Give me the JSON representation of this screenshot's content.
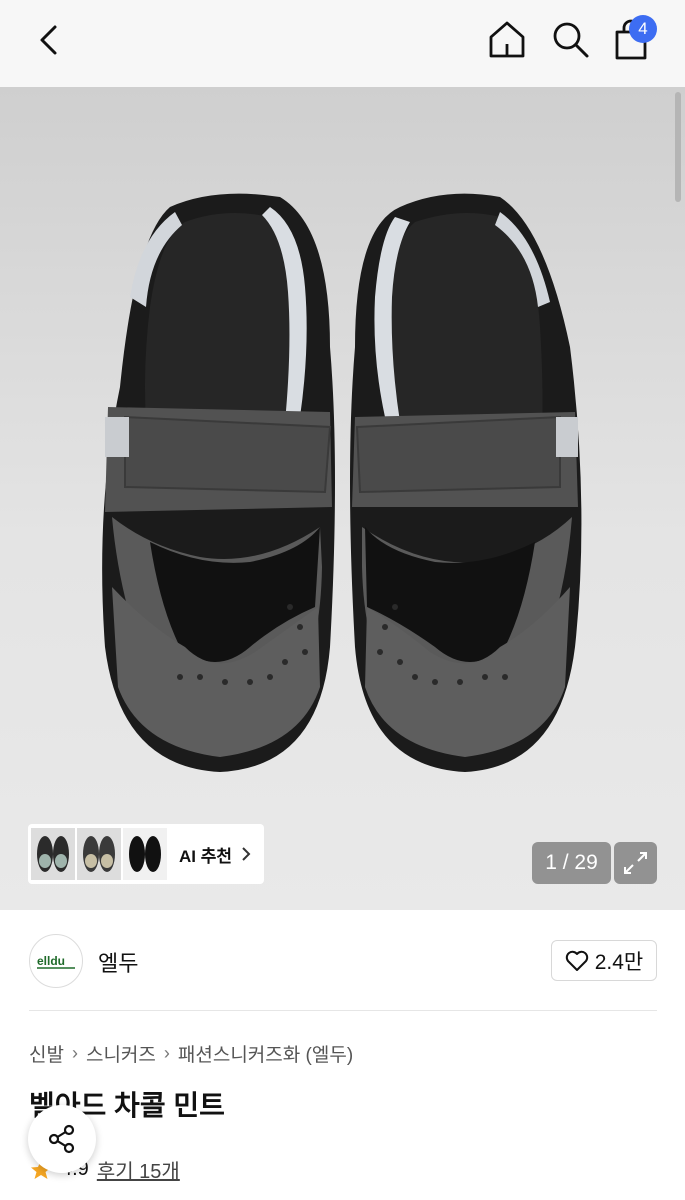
{
  "header": {
    "cart_count": "4"
  },
  "gallery": {
    "counter": "1 / 29",
    "ai_label": "AI 추천"
  },
  "brand": {
    "name": "엘두",
    "logo_text": "elldu",
    "likes": "2.4만"
  },
  "breadcrumb": [
    "신발",
    "스니커즈",
    "패션스니커즈화 (엘두)"
  ],
  "product": {
    "title": "벨아드 차콜 민트",
    "rating": "4.9",
    "reviews": "후기 15개"
  },
  "colors": {
    "accent": "#3d6df2",
    "star": "#f5a623"
  }
}
